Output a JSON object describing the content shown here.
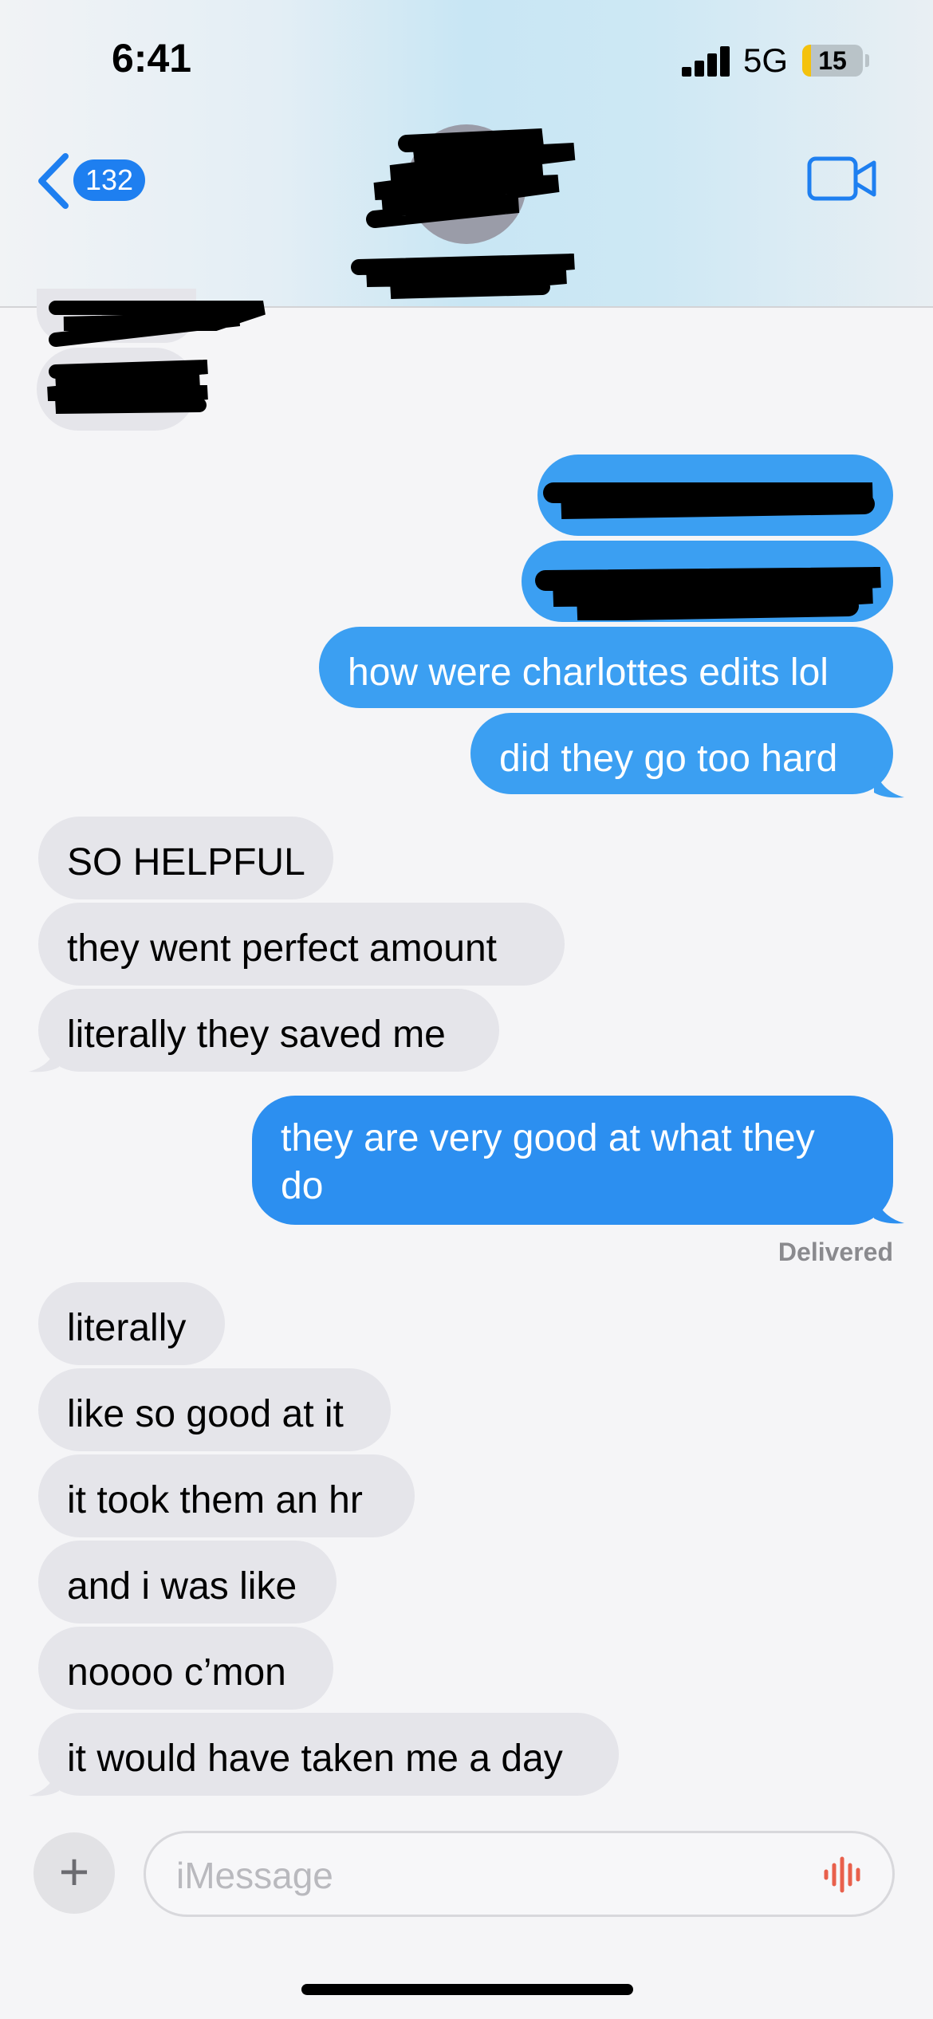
{
  "status_bar": {
    "time": "6:41",
    "network": "5G",
    "battery": "15"
  },
  "header": {
    "back_count": "132"
  },
  "messages": {
    "out_1": "how were charlottes edits lol",
    "out_2": "did they go too hard",
    "in_1": "SO HELPFUL",
    "in_2": "they went perfect amount",
    "in_3": "literally they saved me",
    "out_3": "they are very good at what they do",
    "delivered": "Delivered",
    "in_4": "literally",
    "in_5": "like so good at it",
    "in_6": "it took them an hr",
    "in_7": "and i was like",
    "in_8": "noooo c’mon",
    "in_9": "it would have taken me a day"
  },
  "composer": {
    "placeholder": "iMessage"
  },
  "colors": {
    "accent": "#1e7ff0",
    "outgoing": "#3b9ff2",
    "incoming": "#e5e5ea",
    "mic": "#e8604c"
  }
}
